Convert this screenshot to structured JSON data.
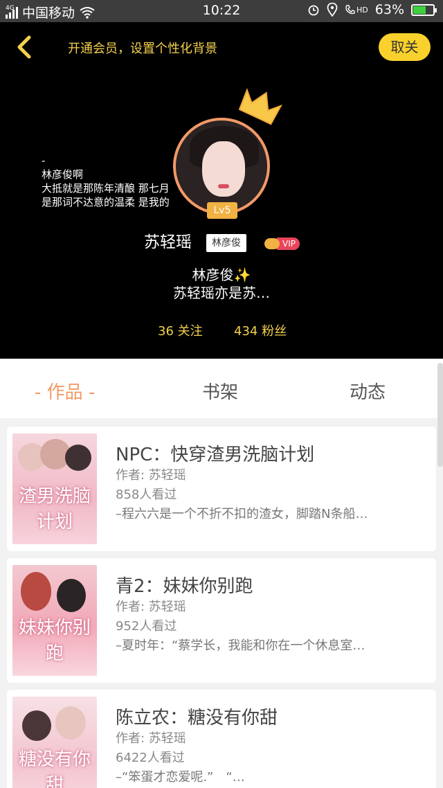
{
  "status_bar": {
    "network": "4G",
    "carrier": "中国移动",
    "time": "10:22",
    "hd_label": "HD",
    "battery": "63%",
    "battery_level": 0.63
  },
  "header": {
    "vip_promo": "开通会员，设置个性化背景",
    "cancel_label": "取关",
    "background_lyrics": [
      "-",
      "林彦俊啊",
      "大抵就是那陈年清酿 那七月",
      "是那词不达意的温柔 是我的"
    ],
    "level": "Lv5",
    "username": "苏轻瑶",
    "name_tag": "林彦俊",
    "vip_label": "VIP",
    "signature_line1": "林彦俊✨",
    "signature_line2": "苏轻瑶亦是苏…",
    "following": "36 关注",
    "fans": "434 粉丝"
  },
  "tabs": [
    {
      "label": "- 作品 -",
      "active": true
    },
    {
      "label": "书架",
      "active": false
    },
    {
      "label": "动态",
      "active": false
    }
  ],
  "books": [
    {
      "title": "NPC：快穿渣男洗脑计划",
      "author": "作者: 苏轻瑶",
      "views": "858人看过",
      "excerpt": "–程六六是一个不折不扣的渣女，脚踏N条船…",
      "cover_text": "渣男洗脑计划"
    },
    {
      "title": "青2：妹妹你别跑",
      "author": "作者: 苏轻瑶",
      "views": "952人看过",
      "excerpt": "–夏时年：“蔡学长，我能和你在一个休息室…",
      "cover_text": "妹妹你别跑"
    },
    {
      "title": "陈立农：糖没有你甜",
      "author": "作者: 苏轻瑶",
      "views": "6422人看过",
      "excerpt": "–“笨蛋才恋爱呢.”　“…",
      "cover_text": "糖没有你甜"
    }
  ],
  "colors": {
    "accent_orange": "#f29a67",
    "gold": "#f4d14c",
    "cancel_bg": "#fad02c",
    "header_bg": "#000000"
  }
}
